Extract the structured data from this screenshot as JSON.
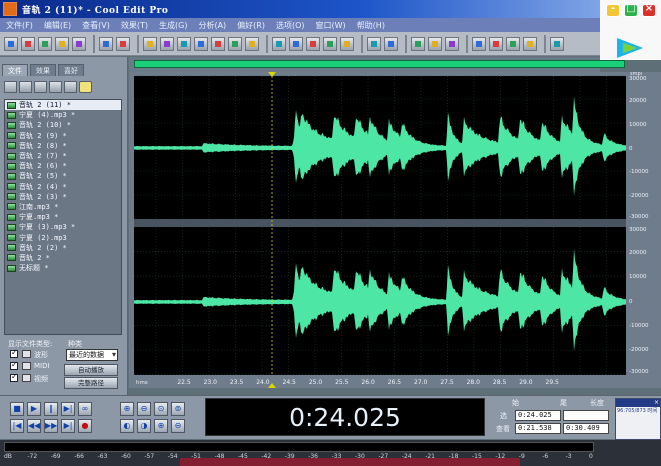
{
  "window": {
    "title": "音轨 2 (11)* - Cool Edit Pro"
  },
  "menubar": {
    "items": [
      "文件(F)",
      "编辑(E)",
      "查看(V)",
      "效果(T)",
      "生成(G)",
      "分析(A)",
      "偏好(R)",
      "选项(O)",
      "窗口(W)",
      "帮助(H)"
    ]
  },
  "left_panel": {
    "tabs": [
      "文件",
      "效果",
      "喜好"
    ],
    "files": [
      "音轨 2 (11) *",
      "宁夏 (4).mp3 *",
      "音轨 2 (10) *",
      "音轨 2 (9) *",
      "音轨 2 (8) *",
      "音轨 2 (7) *",
      "音轨 2 (6) *",
      "音轨 2 (5) *",
      "音轨 2 (4) *",
      "音轨 2 (3) *",
      "江南.mp3 *",
      "宁夏.mp3 *",
      "宁夏 (3).mp3 *",
      "宁夏 (2).mp3",
      "音轨 2 (2) *",
      "音轨 2 *",
      "无标题 *"
    ],
    "filter_label": "显示文件类型:",
    "sort_label": "种类",
    "filter_options": [
      "波形",
      "MIDI",
      "视频"
    ],
    "sort_value": "最近的数据",
    "auto_play_button": "自动播放",
    "full_path_button": "完整路径"
  },
  "waveform": {
    "time_axis_unit": "hms",
    "time_ticks": [
      "22.5",
      "23.0",
      "23.5",
      "24.0",
      "24.5",
      "25.0",
      "25.5",
      "26.0",
      "26.5",
      "27.0",
      "27.5",
      "28.0",
      "28.5",
      "29.0",
      "29.5"
    ],
    "amp_unit": "smpl",
    "amp_ticks": [
      "30000",
      "20000",
      "10000",
      "0",
      "-10000",
      "-20000",
      "-30000"
    ],
    "colors": {
      "background": "#000000",
      "wave": "#4ee6a4",
      "grid": "#1f3a2c",
      "cursor": "#d8d800",
      "axis_bg": "#6f7c8c"
    }
  },
  "transport": {
    "current_time": "0:24.025",
    "selection_header_start": "始",
    "selection_header_end": "尾",
    "selection_header_length": "长度",
    "row1_label": "选",
    "row1_start": "0:24.025",
    "row2_label": "查看",
    "row2_start": "0:21.538",
    "row2_end": "0:30.409"
  },
  "meter": {
    "scale": [
      "dB",
      "-72",
      "-69",
      "-66",
      "-63",
      "-60",
      "-57",
      "-54",
      "-51",
      "-48",
      "-45",
      "-42",
      "-39",
      "-36",
      "-33",
      "-30",
      "-27",
      "-24",
      "-21",
      "-18",
      "-15",
      "-12",
      "-9",
      "-6",
      "-3",
      "0"
    ]
  },
  "popup": {
    "text": "96:705/873 时间"
  }
}
